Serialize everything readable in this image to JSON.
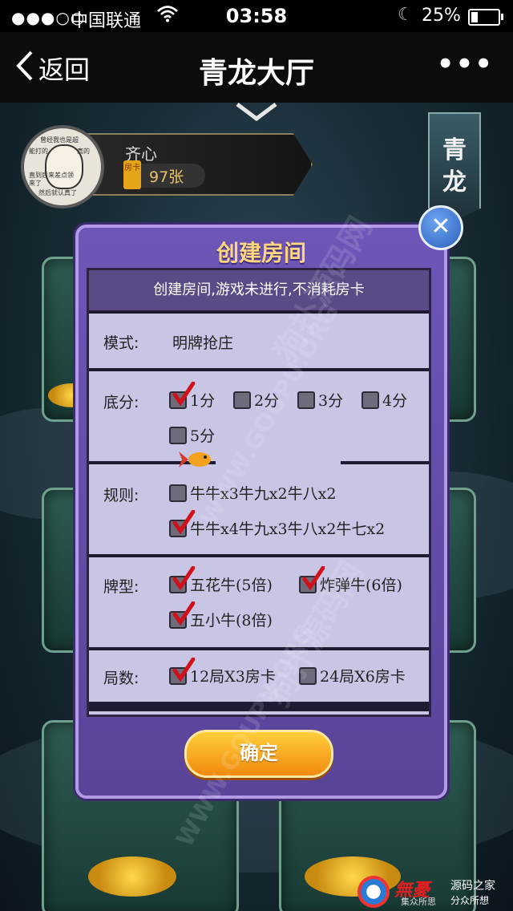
{
  "status_bar": {
    "signal": "●●●○○",
    "carrier": "中国联通",
    "time": "03:58",
    "battery": "25%",
    "battery_level": 0.25
  },
  "nav": {
    "back_label": "返回",
    "title": "青龙大厅",
    "more_label": "•••"
  },
  "player": {
    "name": "齐心",
    "card_icon_text": "房卡",
    "cards": "97张",
    "avatar_text": [
      "曾经我也是超",
      "能打的",
      "真的",
      "直到后来差点领",
      "来了",
      "然后就认真了"
    ]
  },
  "banner_text": [
    "青",
    "龙"
  ],
  "dialog": {
    "title": "创建房间",
    "notice": "创建房间,游戏未进行,不消耗房卡",
    "mode": {
      "label": "模式:",
      "value": "明牌抢庄"
    },
    "base_score": {
      "label": "底分:",
      "options": [
        {
          "text": "1分",
          "checked": true
        },
        {
          "text": "2分",
          "checked": false
        },
        {
          "text": "3分",
          "checked": false
        },
        {
          "text": "4分",
          "checked": false
        },
        {
          "text": "5分",
          "checked": false
        }
      ]
    },
    "rules": {
      "label": "规则:",
      "options": [
        {
          "text": "牛牛x3牛九x2牛八x2",
          "checked": false
        },
        {
          "text": "牛牛x4牛九x3牛八x2牛七x2",
          "checked": true
        }
      ]
    },
    "card_type": {
      "label": "牌型:",
      "options": [
        {
          "text": "五花牛(5倍)",
          "checked": true
        },
        {
          "text": "炸弹牛(6倍)",
          "checked": true
        },
        {
          "text": "五小牛(8倍)",
          "checked": true
        }
      ]
    },
    "rounds": {
      "label": "局数:",
      "options": [
        {
          "text": "12局X3房卡",
          "checked": true
        },
        {
          "text": "24局X6房卡",
          "checked": false
        }
      ]
    },
    "confirm_label": "确定",
    "close_label": "✕"
  },
  "watermark": {
    "text1": "狗扑源码网",
    "text2": "WWW.GOUPU.ORG"
  },
  "footer_logo": {
    "brand": "無憂",
    "line1": "源码之家",
    "line2": "分众所想",
    "line3": "集众所思"
  },
  "colors": {
    "dialog_bg": "#6e56b8",
    "panel_bg": "#c9c5e5",
    "title_text": "#ffd680",
    "confirm_btn": "#f5a623",
    "check_mark": "#d0101a"
  }
}
